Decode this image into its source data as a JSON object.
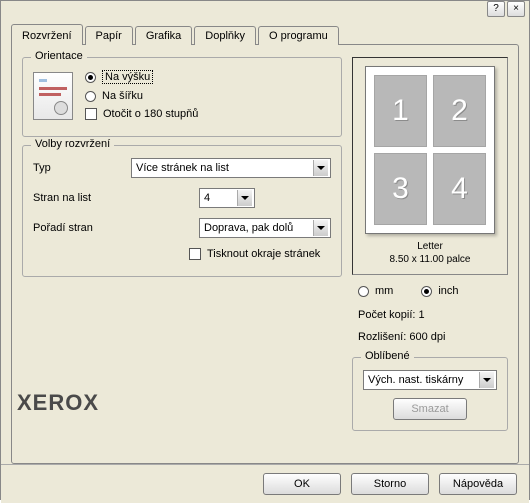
{
  "titlebar": {
    "help": "?",
    "close": "×"
  },
  "tabs": [
    "Rozvržení",
    "Papír",
    "Grafika",
    "Doplňky",
    "O programu"
  ],
  "orientation": {
    "legend": "Orientace",
    "portrait": "Na výšku",
    "landscape": "Na šířku",
    "rotate180": "Otočit o 180 stupňů"
  },
  "layout": {
    "legend": "Volby rozvržení",
    "type_label": "Typ",
    "type_value": "Více stránek na list",
    "pps_label": "Stran na list",
    "pps_value": "4",
    "order_label": "Pořadí stran",
    "order_value": "Doprava, pak dolů",
    "print_border": "Tisknout okraje stránek"
  },
  "preview": {
    "pages": [
      "1",
      "2",
      "3",
      "4"
    ],
    "paper_name": "Letter",
    "paper_dims": "8.50 x 11.00 palce"
  },
  "units": {
    "mm": "mm",
    "inch": "inch"
  },
  "info": {
    "copies_label": "Počet kopií: ",
    "copies_value": "1",
    "res_label": "Rozlišení: ",
    "res_value": "600 dpi"
  },
  "favorites": {
    "legend": "Oblíbené",
    "value": "Vých. nast. tiskárny",
    "delete": "Smazat"
  },
  "brand": "XEROX",
  "buttons": {
    "ok": "OK",
    "cancel": "Storno",
    "help": "Nápověda"
  }
}
